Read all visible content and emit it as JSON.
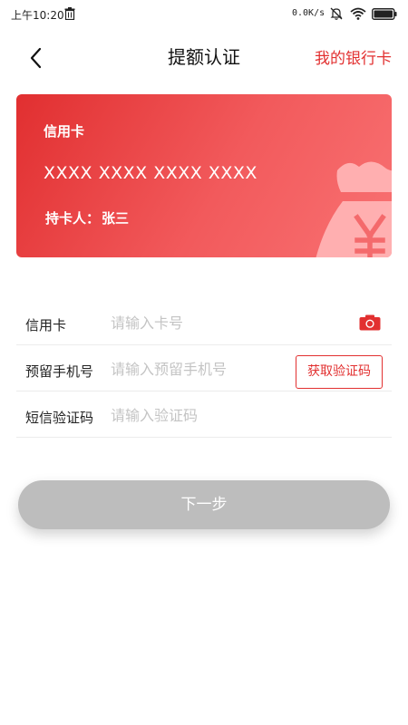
{
  "status_bar": {
    "time": "上午10:20",
    "net_speed": "0.0K/s",
    "icons": [
      "trash-icon",
      "bell-muted-icon",
      "wifi-icon",
      "battery-icon"
    ]
  },
  "header": {
    "back_icon": "chevron-left-icon",
    "title": "提额认证",
    "action_label": "我的银行卡"
  },
  "card": {
    "type_label": "信用卡",
    "number": "XXXX XXXX XXXX XXXX",
    "holder_label": "持卡人：",
    "holder_name": "张三",
    "decoration_icon": "money-bag-icon"
  },
  "form": {
    "card_row": {
      "label": "信用卡",
      "placeholder": "请输入卡号",
      "value": "",
      "icon": "camera-icon"
    },
    "phone_row": {
      "label": "预留手机号",
      "placeholder": "请输入预留手机号",
      "value": "",
      "button_label": "获取验证码"
    },
    "sms_row": {
      "label": "短信验证码",
      "placeholder": "请输入验证码",
      "value": ""
    }
  },
  "next_button": {
    "label": "下一步"
  },
  "colors": {
    "accent": "#e23030",
    "card_gradient_start": "#e12f30",
    "card_gradient_end": "#f87172",
    "disabled_button": "#bdbdbd"
  }
}
